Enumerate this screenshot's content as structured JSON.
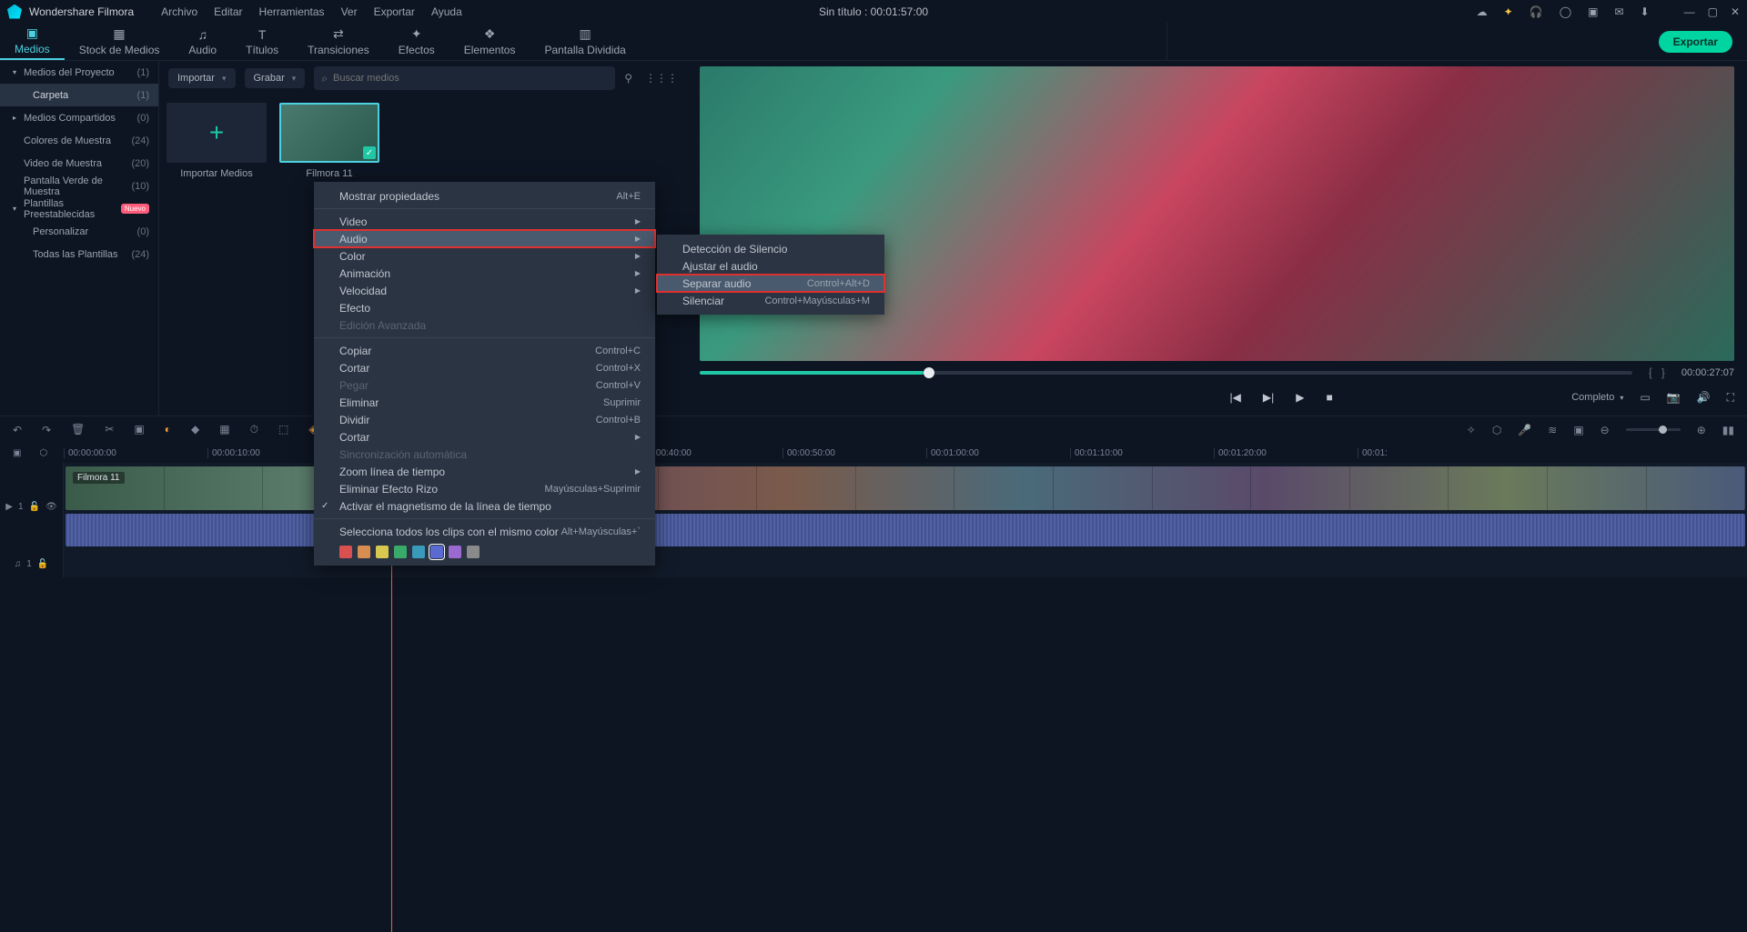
{
  "titlebar": {
    "brand": "Wondershare Filmora",
    "menus": [
      "Archivo",
      "Editar",
      "Herramientas",
      "Ver",
      "Exportar",
      "Ayuda"
    ],
    "center": "Sin título : 00:01:57:00"
  },
  "tabs": {
    "items": [
      {
        "label": "Medios",
        "icon": "▣"
      },
      {
        "label": "Stock de Medios",
        "icon": "▦"
      },
      {
        "label": "Audio",
        "icon": "♫"
      },
      {
        "label": "Títulos",
        "icon": "T"
      },
      {
        "label": "Transiciones",
        "icon": "⇄"
      },
      {
        "label": "Efectos",
        "icon": "✦"
      },
      {
        "label": "Elementos",
        "icon": "❖"
      },
      {
        "label": "Pantalla Dividida",
        "icon": "▥"
      }
    ],
    "export": "Exportar"
  },
  "sidebar": {
    "rows": [
      {
        "label": "Medios del Proyecto",
        "count": "(1)",
        "arrow": "▾"
      },
      {
        "label": "Carpeta",
        "count": "(1)",
        "indent": true,
        "selected": true
      },
      {
        "label": "Medios Compartidos",
        "count": "(0)",
        "arrow": "▸"
      },
      {
        "label": "Colores de Muestra",
        "count": "(24)"
      },
      {
        "label": "Video de Muestra",
        "count": "(20)"
      },
      {
        "label": "Pantalla Verde de Muestra",
        "count": "(10)"
      },
      {
        "label": "Plantillas Preestablecidas",
        "count": "",
        "arrow": "▾",
        "badge": "Nuevo"
      },
      {
        "label": "Personalizar",
        "count": "(0)",
        "indent": true
      },
      {
        "label": "Todas las Plantillas",
        "count": "(24)",
        "indent": true
      }
    ]
  },
  "media": {
    "importar_btn": "Importar",
    "grabar_btn": "Grabar",
    "search_placeholder": "Buscar medios",
    "import_cell": "Importar Medios",
    "clip_cell": "Filmora 11"
  },
  "preview": {
    "time": "00:00:27:07",
    "quality": "Completo"
  },
  "ruler": {
    "ticks": [
      "00:00:00:00",
      "00:00:10:00",
      "",
      "",
      "00:00:40:00",
      "00:00:50:00",
      "00:01:00:00",
      "00:01:10:00",
      "00:01:20:00",
      "00:01:"
    ]
  },
  "ctx_main": {
    "items": [
      {
        "label": "Mostrar propiedades",
        "shortcut": "Alt+E"
      },
      {
        "sep": true
      },
      {
        "label": "Video",
        "arrow": true
      },
      {
        "label": "Audio",
        "arrow": true,
        "hl": true,
        "red": true
      },
      {
        "label": "Color",
        "arrow": true
      },
      {
        "label": "Animación",
        "arrow": true
      },
      {
        "label": "Velocidad",
        "arrow": true
      },
      {
        "label": "Efecto"
      },
      {
        "label": "Edición Avanzada",
        "disabled": true
      },
      {
        "sep": true
      },
      {
        "label": "Copiar",
        "shortcut": "Control+C"
      },
      {
        "label": "Cortar",
        "shortcut": "Control+X"
      },
      {
        "label": "Pegar",
        "shortcut": "Control+V",
        "disabled": true
      },
      {
        "label": "Eliminar",
        "shortcut": "Suprimir"
      },
      {
        "label": "Dividir",
        "shortcut": "Control+B"
      },
      {
        "label": "Cortar",
        "arrow": true
      },
      {
        "label": "Sincronización automática",
        "disabled": true
      },
      {
        "label": "Zoom línea de tiempo",
        "arrow": true
      },
      {
        "label": "Eliminar Efecto Rizo",
        "shortcut": "Mayúsculas+Suprimir"
      },
      {
        "label": "Activar el magnetismo de la línea de tiempo",
        "check": true
      },
      {
        "sep": true
      },
      {
        "label": "Selecciona todos los clips con el mismo color",
        "shortcut": "Alt+Mayúsculas+`"
      }
    ],
    "colors": [
      "#d85050",
      "#d88e50",
      "#d8c850",
      "#3aaa6a",
      "#3a9aba",
      "#5a6ad0",
      "#9a6ad0",
      "#8a8a8a"
    ]
  },
  "ctx_sub": {
    "items": [
      {
        "label": "Detección de Silencio"
      },
      {
        "label": "Ajustar el audio"
      },
      {
        "label": "Separar audio",
        "shortcut": "Control+Alt+D",
        "hl": true,
        "red": true
      },
      {
        "label": "Silenciar",
        "shortcut": "Control+Mayúsculas+M"
      }
    ]
  },
  "track": {
    "video_label": "Filmora 11",
    "v1": "1",
    "a1": "1"
  }
}
